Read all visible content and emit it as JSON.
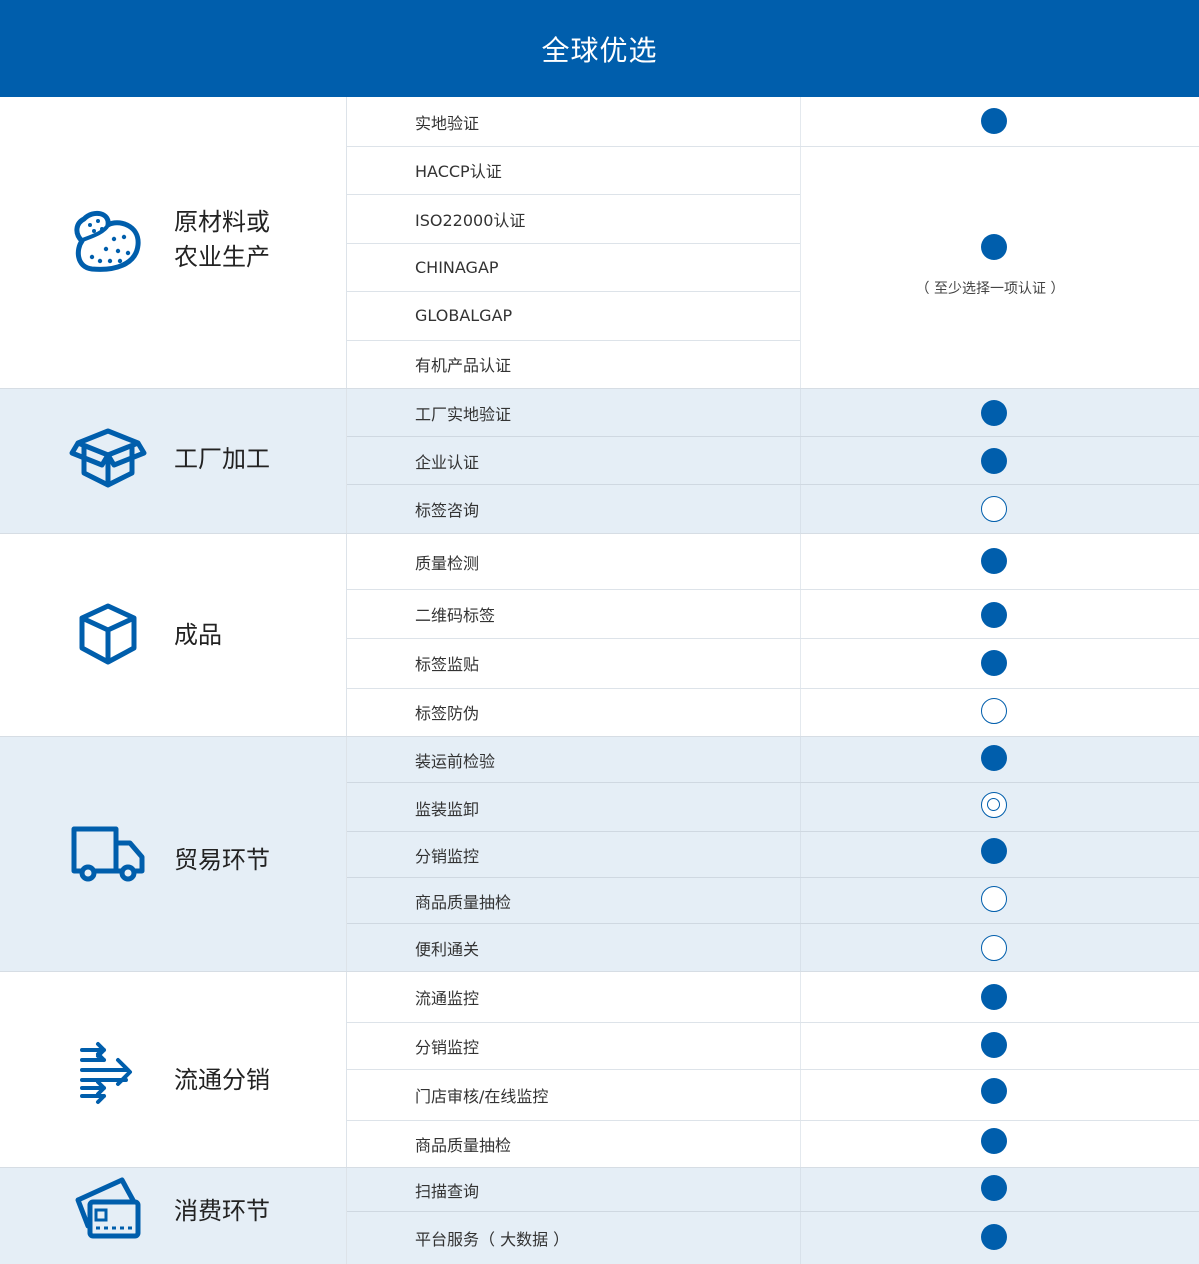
{
  "header": {
    "title": "全球优选"
  },
  "colors": {
    "brand": "#005eac",
    "shaded_row": "#e5eef6"
  },
  "sections": [
    {
      "label": "原材料或\n农业生产",
      "icon": "potato-icon",
      "items": [
        "实地验证",
        "HACCP认证",
        "ISO22000认证",
        "CHINAGAP",
        "GLOBALGAP",
        "有机产品认证"
      ],
      "marks": [
        "filled",
        "filled"
      ],
      "note": "（ 至少选择一项认证 ）"
    },
    {
      "label": "工厂加工",
      "icon": "open-box-icon",
      "items": [
        "工厂实地验证",
        "企业认证",
        "标签咨询"
      ],
      "marks": [
        "filled",
        "filled",
        "empty"
      ]
    },
    {
      "label": "成品",
      "icon": "cube-icon",
      "items": [
        "质量检测",
        "二维码标签",
        "标签监贴",
        "标签防伪"
      ],
      "marks": [
        "filled",
        "filled",
        "filled",
        "empty"
      ]
    },
    {
      "label": "贸易环节",
      "icon": "truck-icon",
      "items": [
        "装运前检验",
        "监装监卸",
        "分销监控",
        "商品质量抽检",
        "便利通关"
      ],
      "marks": [
        "filled",
        "ring",
        "filled",
        "empty",
        "empty"
      ]
    },
    {
      "label": "流通分销",
      "icon": "flow-arrows-icon",
      "items": [
        "流通监控",
        "分销监控",
        "门店审核/在线监控",
        "商品质量抽检"
      ],
      "marks": [
        "filled",
        "filled",
        "filled",
        "filled"
      ]
    },
    {
      "label": "消费环节",
      "icon": "card-icon",
      "items": [
        "扫描查询",
        "平台服务（ 大数据 ）"
      ],
      "marks": [
        "filled",
        "filled"
      ]
    }
  ]
}
